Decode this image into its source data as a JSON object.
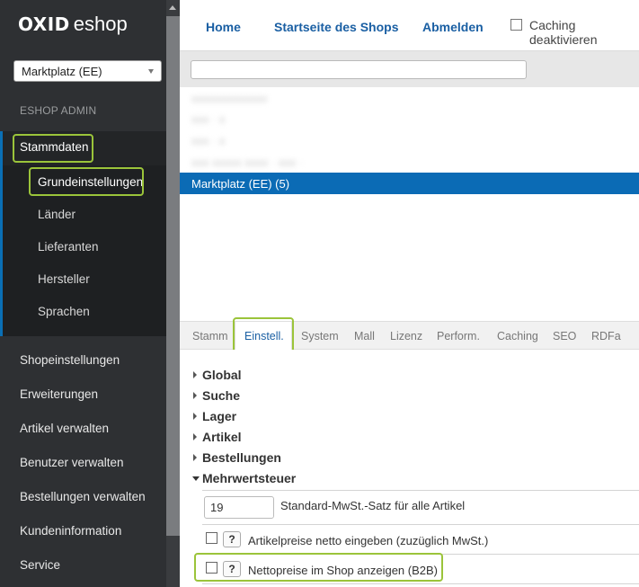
{
  "logo": {
    "part1": "OXID",
    "part2": "eshop"
  },
  "shop_selector": {
    "value": "Marktplatz (EE)"
  },
  "sidebar": {
    "section_title": "ESHOP ADMIN",
    "active_item": "Stammdaten",
    "subitems": [
      "Grundeinstellungen",
      "Länder",
      "Lieferanten",
      "Hersteller",
      "Sprachen"
    ],
    "items": [
      "Shopeinstellungen",
      "Erweiterungen",
      "Artikel verwalten",
      "Benutzer verwalten",
      "Bestellungen verwalten",
      "Kundeninformation",
      "Service"
    ]
  },
  "header": {
    "links": [
      "Home",
      "Startseite des Shops",
      "Abmelden"
    ],
    "caching_label": "Caching deaktivieren"
  },
  "list": {
    "filter_value": "",
    "rows": [
      "xxxxxxxxxxxxx",
      "xxx · x",
      "xxx · x",
      "xxx xxxxx xxxx · xxx ·"
    ],
    "selected_row": "Marktplatz (EE) (5)"
  },
  "tabs": [
    "Stamm",
    "Einstell.",
    "System",
    "Mall",
    "Lizenz",
    "Perform.",
    "Caching",
    "SEO",
    "RDFa"
  ],
  "active_tab": "Einstell.",
  "settings": {
    "groups": [
      "Global",
      "Suche",
      "Lager",
      "Artikel",
      "Bestellungen"
    ],
    "expanded_group": "Mehrwertsteuer",
    "vat_rate_value": "19",
    "vat_rate_label": "Standard-MwSt.-Satz für alle Artikel",
    "opt1_label": "Artikelpreise netto eingeben (zuzüglich MwSt.)",
    "opt2_label": "Nettopreise im Shop anzeigen (B2B)",
    "help_label": "?"
  },
  "colors": {
    "accent": "#0b6bb5",
    "highlight": "#9bc43a",
    "sidebar": "#2e3033"
  }
}
